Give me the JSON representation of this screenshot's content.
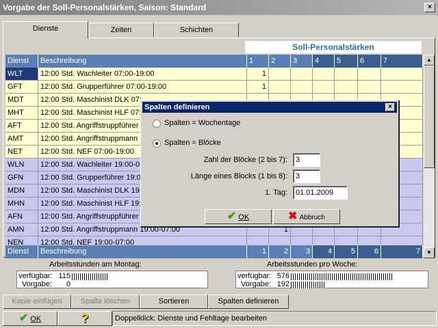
{
  "window": {
    "title": "Vorgabe der Soll-Personalstärken, Saison: Standard",
    "close_glyph": "×"
  },
  "tabs": [
    {
      "label": "Dienste"
    },
    {
      "label": "Zeiten"
    },
    {
      "label": "Schichten"
    }
  ],
  "grid": {
    "section_title": "Soll-Personalstärken",
    "headers": {
      "code": "Dienst",
      "desc": "Beschreibung",
      "cols": [
        "1",
        "2",
        "3",
        "4",
        "5",
        "6",
        "7"
      ]
    },
    "rows": [
      {
        "code": "WLT",
        "desc": "12:00 Std.  Wachleiter 07:00-19:00",
        "c1": "1",
        "c2": ""
      },
      {
        "code": "GFT",
        "desc": "12:00 Std.  Grupperführer 07:00-19:00",
        "c1": "1",
        "c2": ""
      },
      {
        "code": "MDT",
        "desc": "12:00 Std.  Maschinist DLK 07:",
        "c1": "",
        "c2": ""
      },
      {
        "code": "MHT",
        "desc": "12:00 Std.  Maschinist HLF 07:",
        "c1": "",
        "c2": ""
      },
      {
        "code": "AFT",
        "desc": "12:00 Std.  Angriffstruppführer (",
        "c1": "",
        "c2": ""
      },
      {
        "code": "AMT",
        "desc": "12:00 Std.  Angriffstruppmann (",
        "c1": "",
        "c2": ""
      },
      {
        "code": "NET",
        "desc": "12:00 Std.  NEF 07:00-19:00",
        "c1": "",
        "c2": ""
      },
      {
        "code": "WLN",
        "desc": "12:00 Std.  Wachleiter 19:00-0",
        "c1": "",
        "c2": ""
      },
      {
        "code": "GFN",
        "desc": "12:00 Std.  Grupperführer 19:00",
        "c1": "",
        "c2": ""
      },
      {
        "code": "MDN",
        "desc": "12:00 Std.  Maschinist DLK 19:",
        "c1": "",
        "c2": ""
      },
      {
        "code": "MHN",
        "desc": "12:00 Std.  Maschinist HLF 19:",
        "c1": "",
        "c2": ""
      },
      {
        "code": "AFN",
        "desc": "12:00 Std.  Angriffstruppführer 1",
        "c1": "",
        "c2": ""
      },
      {
        "code": "AMN",
        "desc": "12:00 Std.  Angriffstruppmann 19:00-07:00",
        "c1": "",
        "c2": "1"
      },
      {
        "code": "NEN",
        "desc": "12:00 Std.  NEF 19:00-07:00",
        "c1": "",
        "c2": ""
      }
    ],
    "footer": {
      "code": "Dienst",
      "desc": "Beschreibung",
      "cols": [
        "1",
        "2",
        "3",
        "4",
        "5",
        "6",
        "7"
      ]
    }
  },
  "stats": {
    "montag": {
      "title": "Arbeitsstunden am Montag:",
      "verfuegbar_label": "verfügbar:",
      "verfuegbar": "115",
      "vorgabe_label": "Vorgabe:",
      "vorgabe": "0"
    },
    "woche": {
      "title": "Arbeitsstunden pro Woche:",
      "verfuegbar_label": "verfügbar:",
      "verfuegbar": "576",
      "vorgabe_label": "Vorgabe:",
      "vorgabe": "192"
    }
  },
  "toolbar": {
    "kopie": "Kopie einfügen",
    "spalte": "Spalte löschen",
    "sortieren": "Sortieren",
    "definieren": "Spalten definieren"
  },
  "bottom": {
    "ok": "OK",
    "help_glyph": "?",
    "status": "Doppelklick: Dienste und Fehltage bearbeiten"
  },
  "dialog": {
    "title": "Spalten definieren",
    "close_glyph": "×",
    "radio_woche": "Spalten = Wochentage",
    "radio_bloecke": "Spalten = Blöcke",
    "zahl_label": "Zahl der Blöcke (2 bis 7):",
    "zahl_value": "3",
    "laenge_label": "Länge eines Blocks (1 bis 8):",
    "laenge_value": "3",
    "tag_label": "1. Tag:",
    "tag_value": "01.01.2009",
    "ok": "OK",
    "abbruch": "Abbruch",
    "check_glyph": "✔",
    "x_glyph": "✖"
  }
}
